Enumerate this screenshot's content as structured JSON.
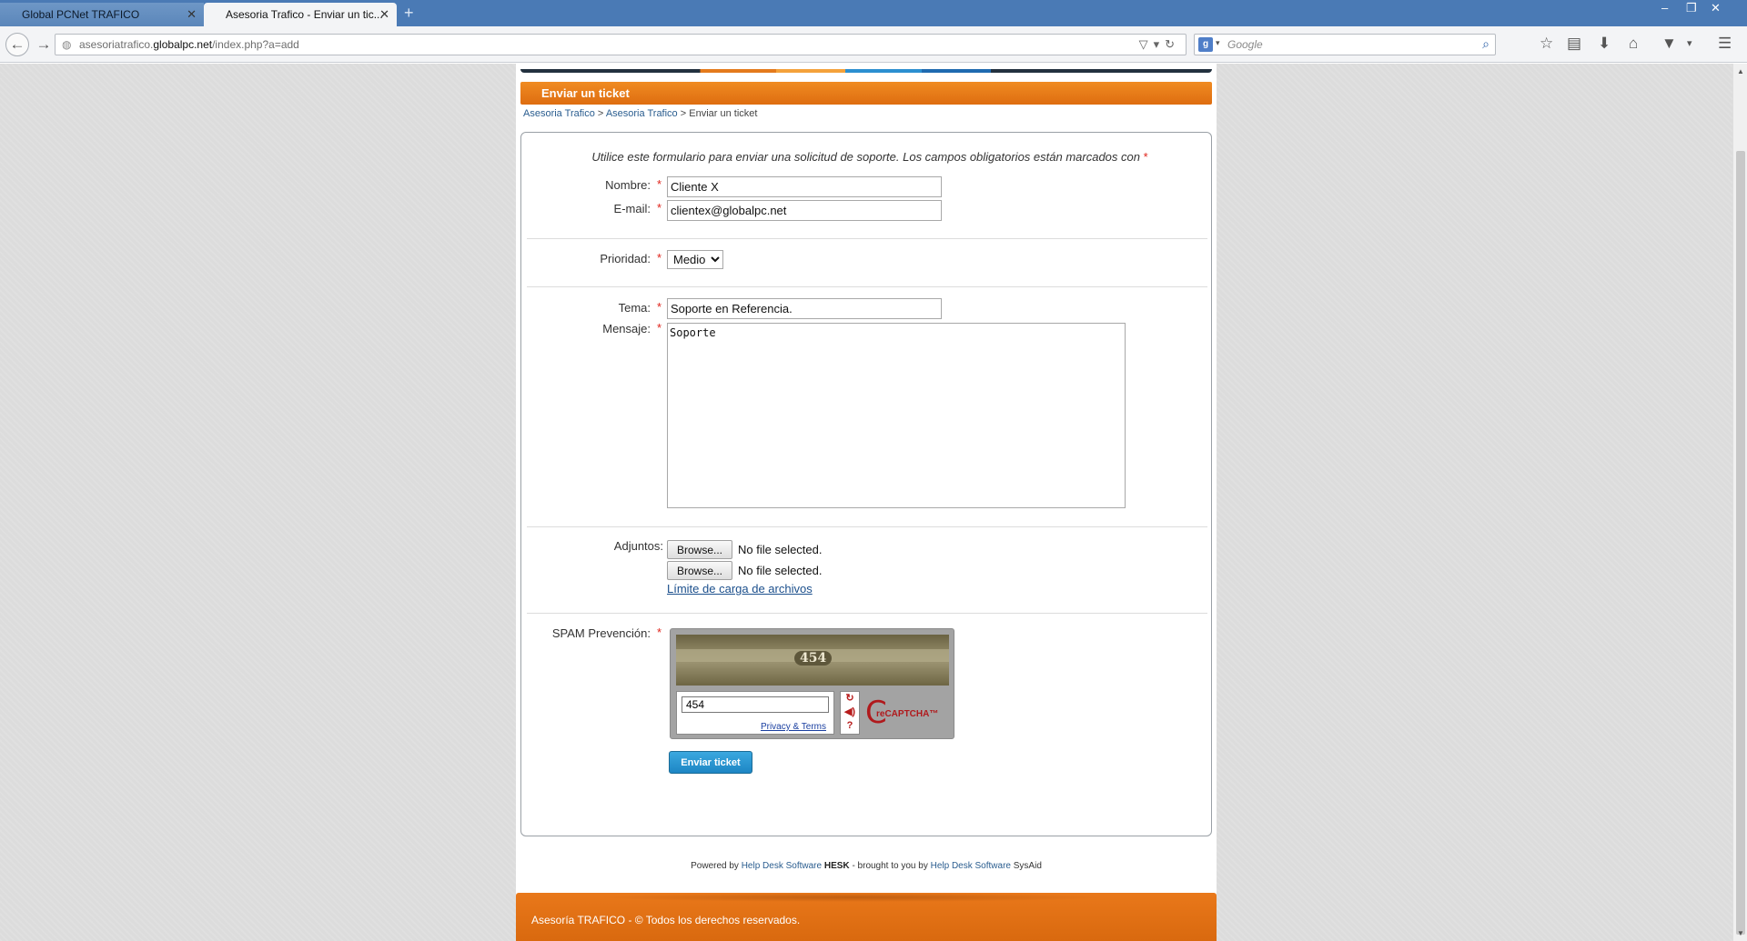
{
  "browser": {
    "tabs": [
      {
        "title": "Global PCNet TRAFICO",
        "active": false
      },
      {
        "title": "Asesoria Trafico - Enviar un tic...",
        "active": true
      }
    ],
    "url_prefix": "asesoriatrafico.",
    "url_domain": "globalpc.net",
    "url_path": "/index.php?a=add",
    "search_placeholder": "Google",
    "search_engine_badge": "g"
  },
  "page": {
    "title": "Enviar un ticket",
    "breadcrumb": [
      "Asesoria Trafico",
      "Asesoria Trafico",
      "Enviar un ticket"
    ],
    "intro": "Utilice este formulario para enviar una solicitud de soporte. Los campos obligatorios están marcados con",
    "required_mark": "*",
    "fields": {
      "nombre_label": "Nombre:",
      "nombre_value": "Cliente X",
      "email_label": "E-mail:",
      "email_value": "clientex@globalpc.net",
      "prioridad_label": "Prioridad:",
      "prioridad_value": "Medio",
      "tema_label": "Tema:",
      "tema_value": "Soporte en Referencia.",
      "mensaje_label": "Mensaje:",
      "mensaje_value": "Soporte",
      "adjuntos_label": "Adjuntos:",
      "browse_label": "Browse...",
      "no_file": "No file selected.",
      "upload_limit_link": "Límite de carga de archivos",
      "spam_label": "SPAM Prevención:"
    },
    "captcha": {
      "image_text": "454",
      "input_value": "454",
      "privacy_terms": "Privacy & Terms",
      "brand": "reCAPTCHA™"
    },
    "submit_label": "Enviar ticket",
    "powered": {
      "prefix": "Powered by",
      "link1": "Help Desk Software",
      "product1": "HESK",
      "mid": "- brought to you by",
      "link2": "Help Desk Software",
      "product2": "SysAid"
    },
    "footer": "Asesoría TRAFICO -  © Todos los derechos reservados."
  },
  "colors": {
    "accent_orange": "#e47a1c",
    "link_blue": "#2a5d8f",
    "required_red": "#e0241b",
    "submit_blue": "#1d86c4"
  }
}
